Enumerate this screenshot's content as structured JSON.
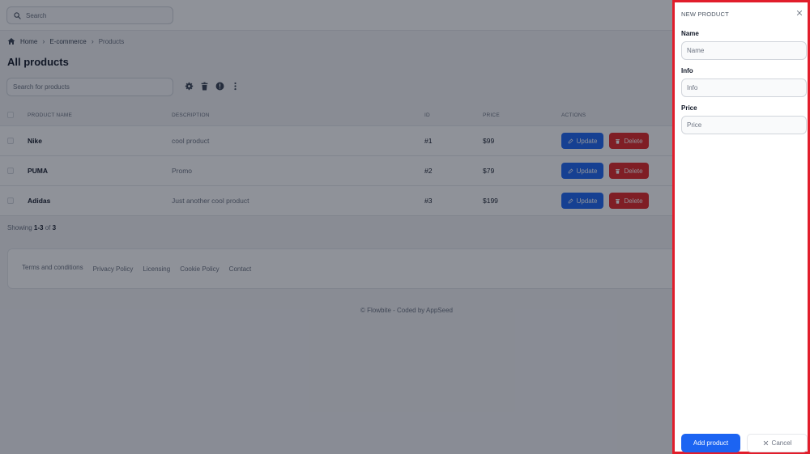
{
  "topbar": {
    "search_placeholder": "Search"
  },
  "breadcrumb": {
    "home": "Home",
    "section": "E-commerce",
    "current": "Products"
  },
  "page": {
    "title": "All products",
    "search_placeholder": "Search for products"
  },
  "table": {
    "headers": {
      "name": "PRODUCT NAME",
      "description": "DESCRIPTION",
      "id": "ID",
      "price": "PRICE",
      "actions": "ACTIONS"
    },
    "rows": [
      {
        "name": "Nike",
        "description": "cool product",
        "id": "#1",
        "price": "$99"
      },
      {
        "name": "PUMA",
        "description": "Promo",
        "id": "#2",
        "price": "$79"
      },
      {
        "name": "Adidas",
        "description": "Just another cool product",
        "id": "#3",
        "price": "$199"
      }
    ],
    "update_label": "Update",
    "delete_label": "Delete"
  },
  "pagination": {
    "prefix": "Showing",
    "range": "1-3",
    "of": "of",
    "total": "3"
  },
  "footer": {
    "links": [
      "Terms and conditions",
      "Privacy Policy",
      "Licensing",
      "Cookie Policy",
      "Contact"
    ],
    "copyright": "© Flowbite - Coded by AppSeed"
  },
  "drawer": {
    "title": "NEW PRODUCT",
    "fields": [
      {
        "label": "Name",
        "placeholder": "Name"
      },
      {
        "label": "Info",
        "placeholder": "Info"
      },
      {
        "label": "Price",
        "placeholder": "Price"
      }
    ],
    "add_label": "Add product",
    "cancel_label": "Cancel"
  },
  "colors": {
    "primary": "#1c64f2",
    "danger": "#e02424",
    "highlight_border": "#e11d2b"
  },
  "icons": [
    "search-icon",
    "home-icon",
    "gear-icon",
    "trash-icon",
    "alert-icon",
    "more-vertical-icon",
    "edit-icon",
    "close-icon"
  ]
}
